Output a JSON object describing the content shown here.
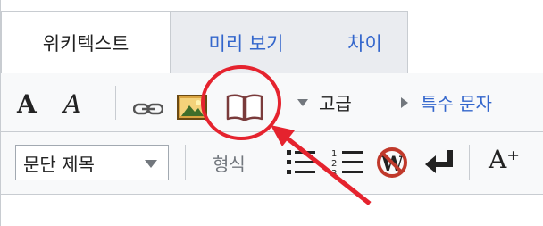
{
  "tabs": [
    {
      "label": "위키텍스트"
    },
    {
      "label": "미리 보기"
    },
    {
      "label": "차이"
    }
  ],
  "toolbar": {
    "bold_label": "A",
    "italic_label": "A",
    "advanced_label": "고급",
    "special_chars_label": "특수 문자"
  },
  "toolbar2": {
    "section_select_value": "문단 제목",
    "format_label": "형식",
    "big_label": "A⁺"
  },
  "icons": [
    "link-icon",
    "image-icon",
    "reference-book-icon",
    "bulleted-list-icon",
    "numbered-list-icon",
    "nowiki-icon",
    "newline-icon"
  ],
  "annotation": {
    "circle_color": "#e5232e",
    "arrow_color": "#e5232e"
  }
}
